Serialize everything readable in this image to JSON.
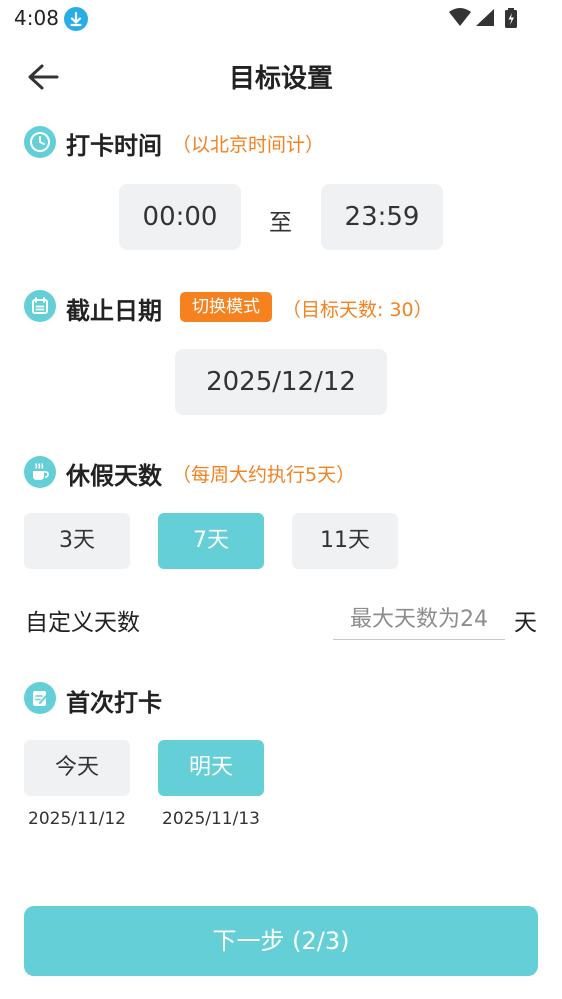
{
  "status_bar": {
    "time": "4:08"
  },
  "header": {
    "title": "目标设置"
  },
  "checkin_time": {
    "title": "打卡时间",
    "hint": "（以北京时间计）",
    "start": "00:00",
    "separator": "至",
    "end": "23:59"
  },
  "deadline": {
    "title": "截止日期",
    "mode_button": "切换模式",
    "hint": "（目标天数: 30）",
    "date": "2025/12/12"
  },
  "vacation": {
    "title": "休假天数",
    "hint": "（每周大约执行5天）",
    "options": [
      {
        "label": "3天",
        "selected": false
      },
      {
        "label": "7天",
        "selected": true
      },
      {
        "label": "11天",
        "selected": false
      }
    ],
    "custom_label": "自定义天数",
    "custom_placeholder": "最大天数为24",
    "custom_unit": "天"
  },
  "first_checkin": {
    "title": "首次打卡",
    "options": [
      {
        "label": "今天",
        "date": "2025/11/12",
        "selected": false
      },
      {
        "label": "明天",
        "date": "2025/11/13",
        "selected": true
      }
    ]
  },
  "footer": {
    "next_label": "下一步 (2/3)"
  },
  "colors": {
    "accent": "#64cfd6",
    "orange": "#f5821f",
    "box_gray": "#f0f1f3"
  },
  "icons": [
    "download-icon",
    "wifi-icon",
    "cellular-signal-icon",
    "battery-icon",
    "back-arrow-icon",
    "clock-icon",
    "calendar-icon",
    "coffee-cup-icon",
    "edit-note-icon"
  ]
}
